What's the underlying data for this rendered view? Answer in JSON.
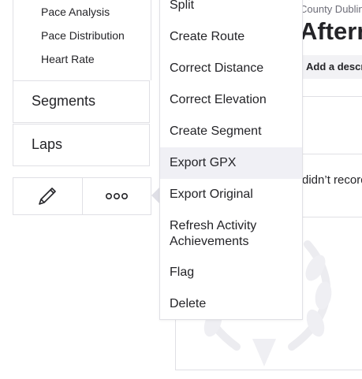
{
  "sidebar": {
    "sub_items": [
      "Pace Analysis",
      "Pace Distribution",
      "Heart Rate"
    ],
    "sections": [
      "Segments",
      "Laps"
    ],
    "tools": {
      "edit_icon": "pencil-icon",
      "more_icon": "ellipsis-icon"
    }
  },
  "menu": {
    "items": [
      "Split",
      "Create Route",
      "Correct Distance",
      "Correct Elevation",
      "Create Segment",
      "Export GPX",
      "Export Original",
      "Refresh Activity Achievements",
      "Flag",
      "Delete"
    ],
    "highlighted": "Export GPX"
  },
  "activity": {
    "location": "County Dublin",
    "title": "Afternoon",
    "add_description": "Add a description",
    "no_record_text": "didn’t record"
  },
  "colors": {
    "text": "#242428",
    "border": "#e0e0e5",
    "highlight": "#f0f0f5",
    "muted": "#6d6d78"
  }
}
